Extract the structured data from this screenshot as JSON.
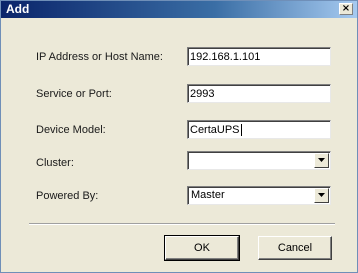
{
  "dialog": {
    "title": "Add",
    "close_glyph": "×"
  },
  "form": {
    "ip_address": {
      "label": "IP Address or Host Name:",
      "value": "192.168.1.101"
    },
    "service_port": {
      "label": "Service or Port:",
      "value": "2993"
    },
    "device_model": {
      "label": "Device Model:",
      "value": "CertaUPS"
    },
    "cluster": {
      "label": "Cluster:",
      "value": ""
    },
    "powered_by": {
      "label": "Powered By:",
      "value": "Master"
    }
  },
  "buttons": {
    "ok_label": "OK",
    "cancel_label": "Cancel"
  },
  "icons": {
    "close": "close-icon",
    "dropdown": "chevron-down-icon"
  }
}
